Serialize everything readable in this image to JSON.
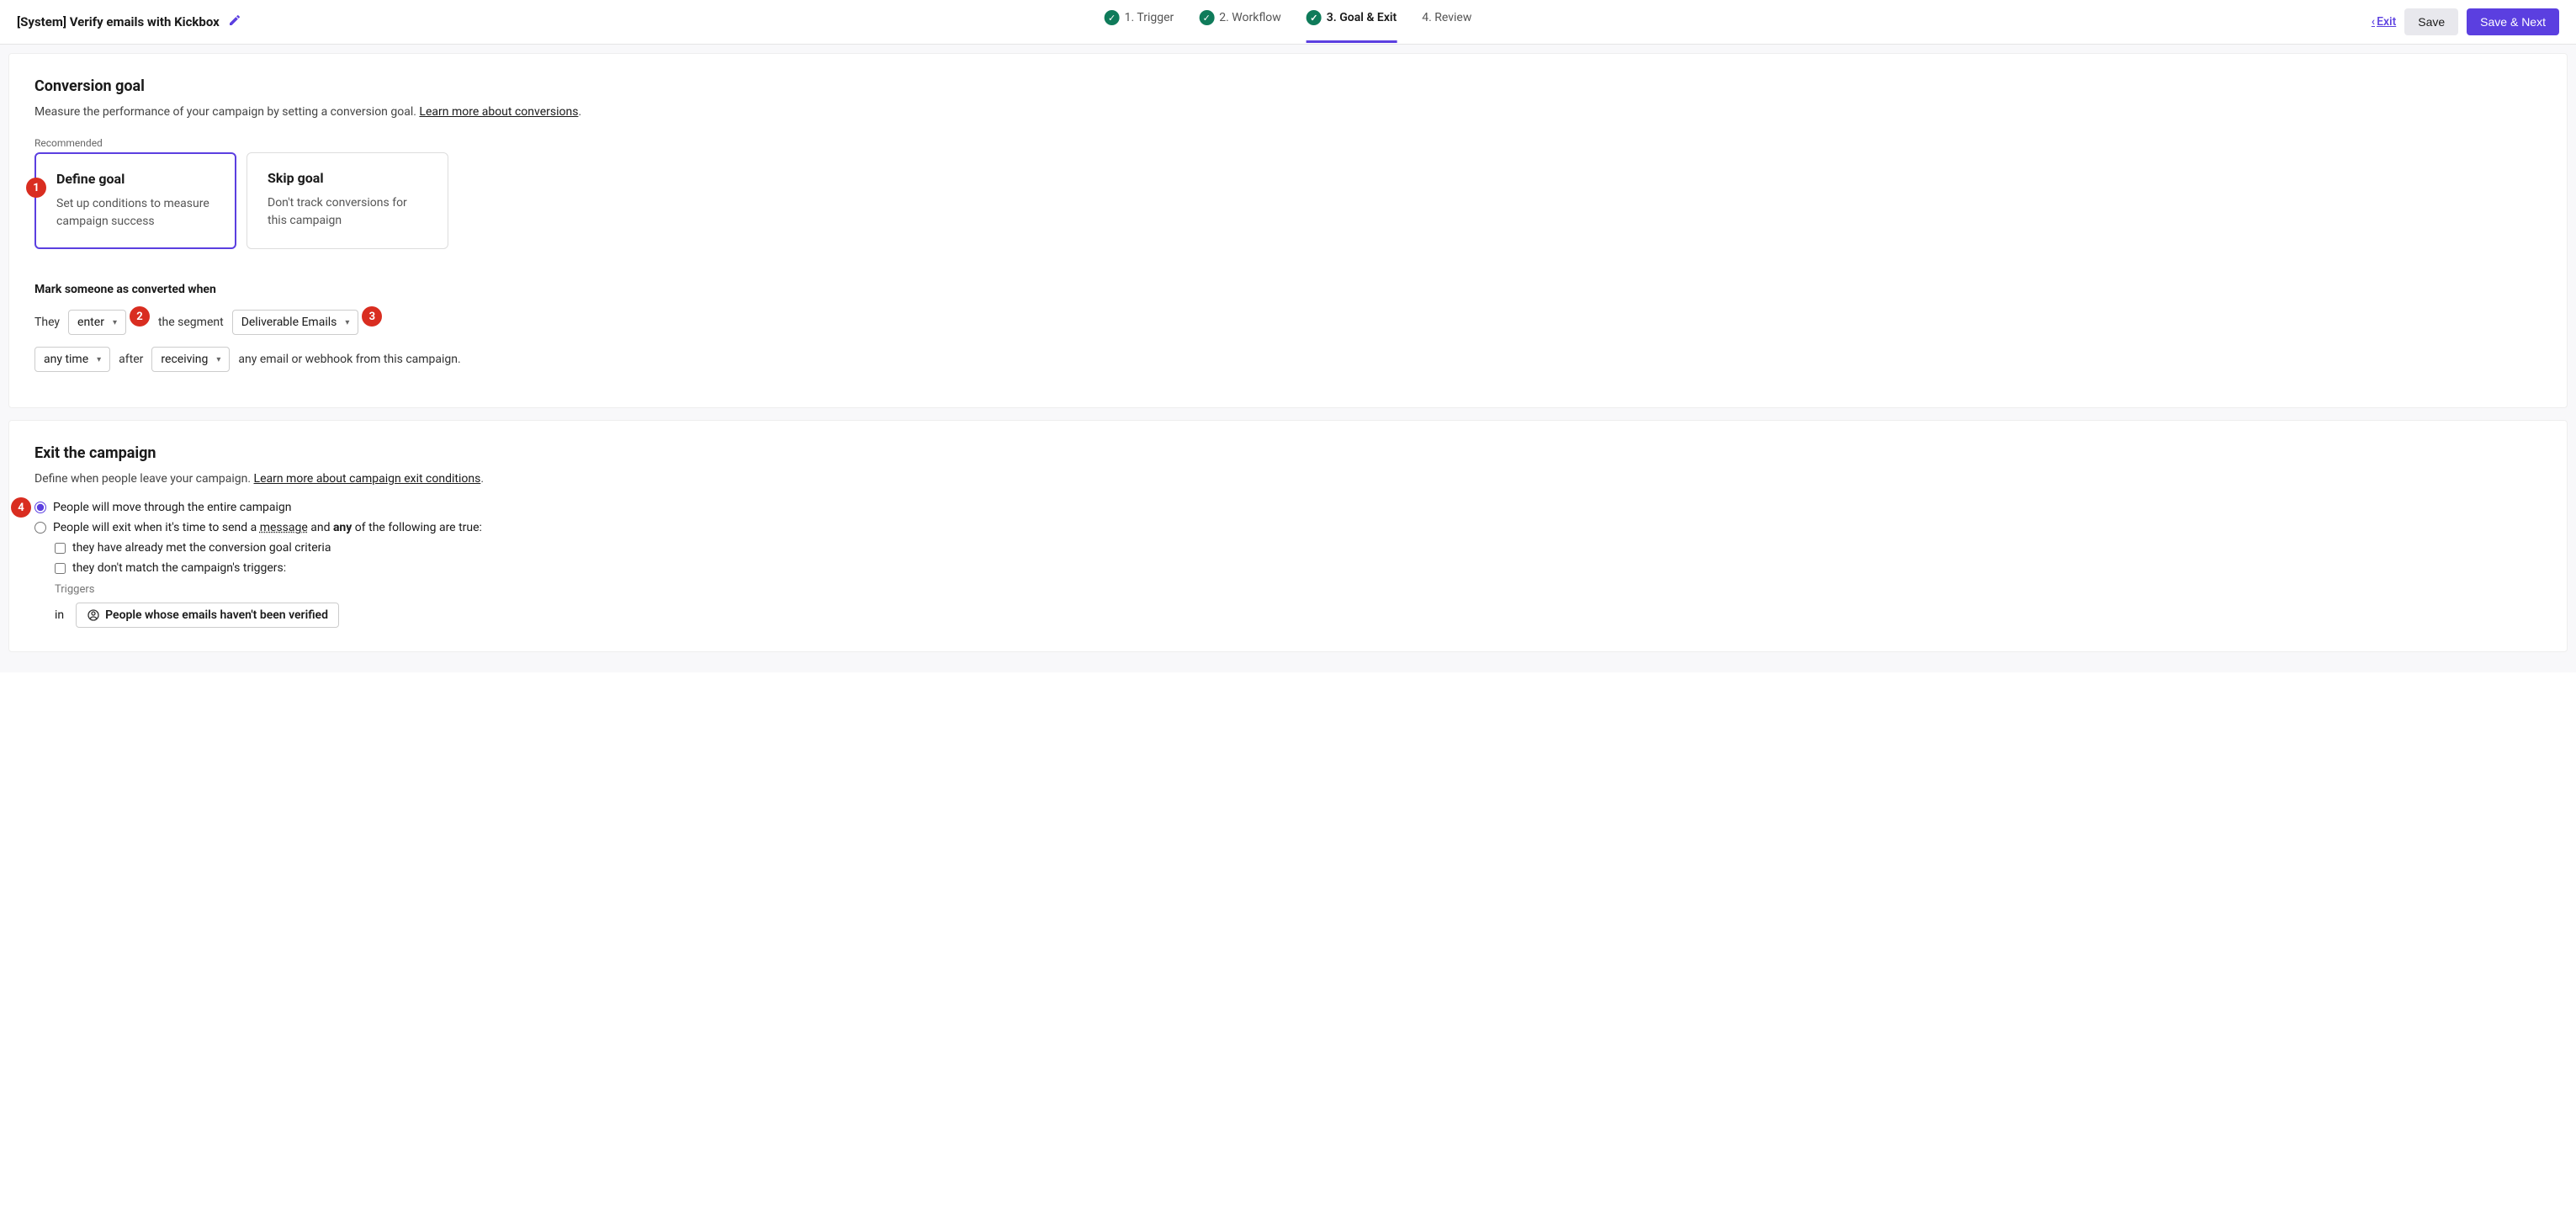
{
  "header": {
    "title": "[System] Verify emails with Kickbox",
    "steps": {
      "s1": "1. Trigger",
      "s2": "2. Workflow",
      "s3": "3. Goal & Exit",
      "s4": "4. Review"
    },
    "exit": "Exit",
    "save": "Save",
    "save_next": "Save & Next"
  },
  "conversion": {
    "title": "Conversion goal",
    "desc": "Measure the performance of your campaign by setting a conversion goal. ",
    "learn_more": "Learn more about conversions",
    "recommended": "Recommended",
    "define": {
      "title": "Define goal",
      "desc": "Set up conditions to measure campaign success"
    },
    "skip": {
      "title": "Skip goal",
      "desc": "Don't track conversions for this campaign"
    },
    "mark_title": "Mark someone as converted when",
    "they": "They",
    "enter_select": "enter",
    "the_segment": "the segment",
    "segment_select": "Deliverable Emails",
    "anytime_select": "any time",
    "after": "after",
    "receiving_select": "receiving",
    "tail": "any email or webhook from this campaign."
  },
  "exit": {
    "title": "Exit the campaign",
    "desc": "Define when people leave your campaign. ",
    "learn_more": "Learn more about campaign exit conditions",
    "radio1": "People will move through the entire campaign",
    "radio2_pre": "People will exit when it's time to send a ",
    "radio2_msg": "message",
    "radio2_mid": " and ",
    "radio2_any": "any",
    "radio2_post": " of the following are true:",
    "check1": "they have already met the conversion goal criteria",
    "check2": "they don't match the campaign's triggers:",
    "triggers_label": "Triggers",
    "in": "in",
    "trigger_pill": "People whose emails haven't been verified"
  },
  "badges": {
    "b1": "1",
    "b2": "2",
    "b3": "3",
    "b4": "4"
  }
}
